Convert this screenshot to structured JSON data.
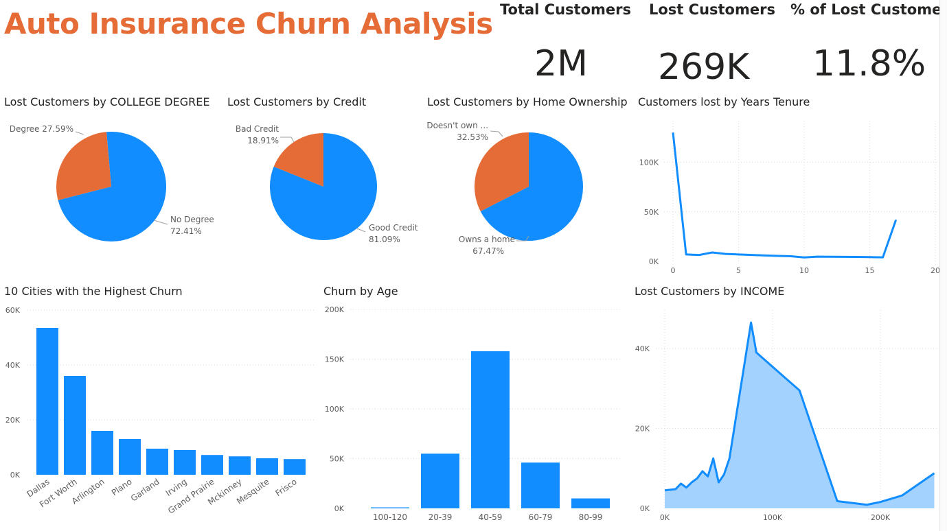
{
  "header": {
    "title": "Auto Insurance Churn Analysis"
  },
  "kpis": [
    {
      "label": "Total Customers",
      "value": "2M"
    },
    {
      "label": "Lost Customers",
      "value": "269K"
    },
    {
      "label": "% of Lost Customers",
      "value": "11.8%"
    }
  ],
  "colors": {
    "blue": "#118DFF",
    "orange": "#E66C37",
    "area_fill": "#A3D2FF",
    "title_orange": "#E66C37"
  },
  "chart_data": [
    {
      "id": "college",
      "type": "pie",
      "title": "Lost Customers by COLLEGE DEGREE",
      "slices": [
        {
          "label": "No Degree",
          "value": 72.41,
          "display": "72.41%",
          "color": "#118DFF"
        },
        {
          "label": "Degree",
          "value": 27.59,
          "display": "27.59%",
          "color": "#E66C37"
        }
      ]
    },
    {
      "id": "credit",
      "type": "pie",
      "title": "Lost Customers by Credit",
      "slices": [
        {
          "label": "Good Credit",
          "value": 81.09,
          "display": "81.09%",
          "color": "#118DFF"
        },
        {
          "label": "Bad Credit",
          "value": 18.91,
          "display": "18.91%",
          "color": "#E66C37"
        }
      ]
    },
    {
      "id": "home",
      "type": "pie",
      "title": "Lost Customers by Home Ownership",
      "slices": [
        {
          "label": "Owns a home",
          "value": 67.47,
          "display": "67.47%",
          "color": "#118DFF"
        },
        {
          "label": "Doesn't own ...",
          "value": 32.53,
          "display": "32.53%",
          "color": "#E66C37"
        }
      ]
    },
    {
      "id": "tenure",
      "type": "line",
      "title": "Customers lost by Years Tenure",
      "x": [
        0,
        1,
        2,
        3,
        4,
        5,
        6,
        7,
        8,
        9,
        10,
        11,
        12,
        13,
        14,
        15,
        16,
        17
      ],
      "y": [
        130000,
        7000,
        6500,
        9000,
        7500,
        7000,
        6500,
        6000,
        5500,
        5200,
        4000,
        4800,
        4700,
        4600,
        4500,
        4300,
        4100,
        42000
      ],
      "xlim": [
        0,
        20
      ],
      "xticks": [
        0,
        5,
        10,
        15,
        20
      ],
      "ylim": [
        0,
        135000
      ],
      "yticks": [
        0,
        50000,
        100000
      ],
      "yticklabels": [
        "0K",
        "50K",
        "100K"
      ],
      "grid": true
    },
    {
      "id": "cities",
      "type": "bar",
      "title": "10 Cities with the Highest Churn",
      "categories": [
        "Dallas",
        "Fort Worth",
        "Arlington",
        "Plano",
        "Garland",
        "Irving",
        "Grand Prairie",
        "Mckinney",
        "Mesquite",
        "Frisco"
      ],
      "values": [
        53500,
        36000,
        16000,
        13000,
        9500,
        9000,
        7200,
        6700,
        6000,
        5700
      ],
      "ylim": [
        0,
        60000
      ],
      "yticks": [
        0,
        20000,
        40000,
        60000
      ],
      "yticklabels": [
        "0K",
        "20K",
        "40K",
        "60K"
      ],
      "grid": true
    },
    {
      "id": "age",
      "type": "bar",
      "title": "Churn by Age",
      "categories": [
        "100-120",
        "20-39",
        "40-59",
        "60-79",
        "80-99"
      ],
      "values": [
        1000,
        55000,
        158000,
        46000,
        10000
      ],
      "ylim": [
        0,
        200000
      ],
      "yticks": [
        0,
        50000,
        100000,
        150000,
        200000
      ],
      "yticklabels": [
        "0K",
        "50K",
        "100K",
        "150K",
        "200K"
      ],
      "grid": true
    },
    {
      "id": "income",
      "type": "area",
      "title": "Lost Customers by INCOME",
      "x": [
        0,
        10000,
        15000,
        20000,
        25000,
        30000,
        35000,
        40000,
        45000,
        50000,
        55000,
        60000,
        80000,
        85000,
        125000,
        160000,
        187500,
        200000,
        220000,
        250000
      ],
      "y": [
        4500,
        4800,
        6200,
        5200,
        6500,
        7500,
        9300,
        8000,
        12500,
        6500,
        8500,
        12500,
        46500,
        39000,
        29500,
        1800,
        900,
        1600,
        3200,
        8800
      ],
      "xlim": [
        0,
        250000
      ],
      "xticks": [
        0,
        100000,
        200000
      ],
      "xticklabels": [
        "0K",
        "100K",
        "200K"
      ],
      "ylim": [
        0,
        50000
      ],
      "yticks": [
        0,
        20000,
        40000
      ],
      "yticklabels": [
        "0K",
        "20K",
        "40K"
      ],
      "grid": true
    }
  ]
}
